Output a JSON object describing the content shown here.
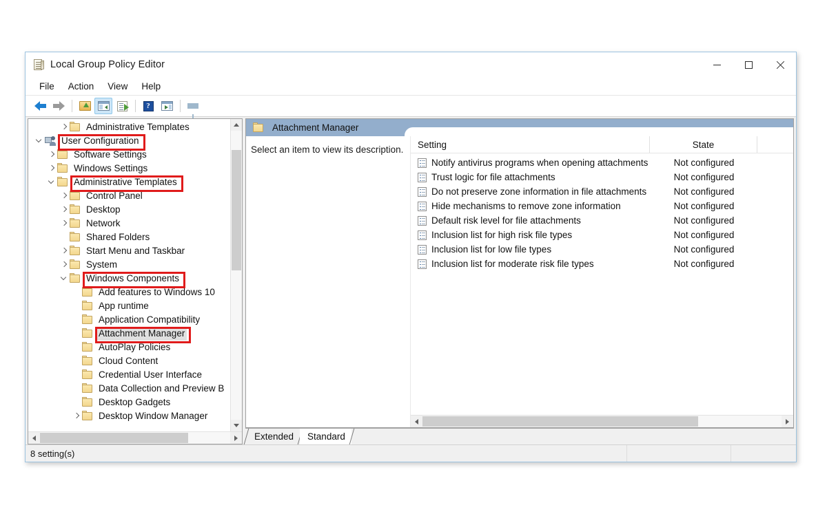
{
  "window": {
    "title": "Local Group Policy Editor",
    "icon": "policy-document-icon",
    "controls": {
      "minimize": "—",
      "maximize": "□",
      "close": "✕"
    }
  },
  "menubar": {
    "items": [
      {
        "label": "File"
      },
      {
        "label": "Action"
      },
      {
        "label": "View"
      },
      {
        "label": "Help"
      }
    ]
  },
  "toolbar": {
    "buttons": [
      {
        "name": "back-arrow-icon",
        "tooltip": "Back"
      },
      {
        "name": "forward-arrow-icon",
        "tooltip": "Forward"
      },
      {
        "name": "up-one-level-icon",
        "tooltip": "Up One Level"
      },
      {
        "name": "show-hide-console-tree-icon",
        "tooltip": "Show/Hide Console Tree",
        "pressed": true
      },
      {
        "name": "export-list-icon",
        "tooltip": "Export List"
      },
      {
        "name": "help-icon",
        "tooltip": "Help",
        "glyph": "?"
      },
      {
        "name": "properties-icon",
        "tooltip": "Properties"
      },
      {
        "name": "filter-funnel-icon",
        "tooltip": "Filter"
      }
    ]
  },
  "tree": {
    "items": [
      {
        "label": "Administrative Templates",
        "depth": 2,
        "expander": "collapsed",
        "icon": "folder-icon",
        "selected": false,
        "highlighted": false
      },
      {
        "label": "User Configuration",
        "depth": 0,
        "expander": "expanded",
        "icon": "user-configuration-icon",
        "selected": false,
        "highlighted": true
      },
      {
        "label": "Software Settings",
        "depth": 1,
        "expander": "collapsed",
        "icon": "folder-icon",
        "selected": false,
        "highlighted": false
      },
      {
        "label": "Windows Settings",
        "depth": 1,
        "expander": "collapsed",
        "icon": "folder-icon",
        "selected": false,
        "highlighted": false
      },
      {
        "label": "Administrative Templates",
        "depth": 1,
        "expander": "expanded",
        "icon": "folder-icon",
        "selected": false,
        "highlighted": true
      },
      {
        "label": "Control Panel",
        "depth": 2,
        "expander": "collapsed",
        "icon": "folder-icon",
        "selected": false,
        "highlighted": false
      },
      {
        "label": "Desktop",
        "depth": 2,
        "expander": "collapsed",
        "icon": "folder-icon",
        "selected": false,
        "highlighted": false
      },
      {
        "label": "Network",
        "depth": 2,
        "expander": "collapsed",
        "icon": "folder-icon",
        "selected": false,
        "highlighted": false
      },
      {
        "label": "Shared Folders",
        "depth": 2,
        "expander": "none",
        "icon": "folder-icon",
        "selected": false,
        "highlighted": false
      },
      {
        "label": "Start Menu and Taskbar",
        "depth": 2,
        "expander": "collapsed",
        "icon": "folder-icon",
        "selected": false,
        "highlighted": false
      },
      {
        "label": "System",
        "depth": 2,
        "expander": "collapsed",
        "icon": "folder-icon",
        "selected": false,
        "highlighted": false
      },
      {
        "label": "Windows Components",
        "depth": 2,
        "expander": "expanded",
        "icon": "folder-icon",
        "selected": false,
        "highlighted": true
      },
      {
        "label": "Add features to Windows 10",
        "depth": 3,
        "expander": "none",
        "icon": "folder-icon",
        "selected": false,
        "highlighted": false
      },
      {
        "label": "App runtime",
        "depth": 3,
        "expander": "none",
        "icon": "folder-icon",
        "selected": false,
        "highlighted": false
      },
      {
        "label": "Application Compatibility",
        "depth": 3,
        "expander": "none",
        "icon": "folder-icon",
        "selected": false,
        "highlighted": false
      },
      {
        "label": "Attachment Manager",
        "depth": 3,
        "expander": "none",
        "icon": "folder-icon",
        "selected": true,
        "highlighted": true
      },
      {
        "label": "AutoPlay Policies",
        "depth": 3,
        "expander": "none",
        "icon": "folder-icon",
        "selected": false,
        "highlighted": false
      },
      {
        "label": "Cloud Content",
        "depth": 3,
        "expander": "none",
        "icon": "folder-icon",
        "selected": false,
        "highlighted": false
      },
      {
        "label": "Credential User Interface",
        "depth": 3,
        "expander": "none",
        "icon": "folder-icon",
        "selected": false,
        "highlighted": false
      },
      {
        "label": "Data Collection and Preview B",
        "depth": 3,
        "expander": "none",
        "icon": "folder-icon",
        "selected": false,
        "highlighted": false
      },
      {
        "label": "Desktop Gadgets",
        "depth": 3,
        "expander": "none",
        "icon": "folder-icon",
        "selected": false,
        "highlighted": false
      },
      {
        "label": "Desktop Window Manager",
        "depth": 3,
        "expander": "collapsed",
        "icon": "folder-icon",
        "selected": false,
        "highlighted": false
      }
    ]
  },
  "right_panel": {
    "tab_title": "Attachment Manager",
    "tab_icon": "folder-icon",
    "description": "Select an item to view its description.",
    "columns": {
      "setting": "Setting",
      "state": "State",
      "comment": ""
    },
    "rows": [
      {
        "setting": "Notify antivirus programs when opening attachments",
        "state": "Not configured"
      },
      {
        "setting": "Trust logic for file attachments",
        "state": "Not configured"
      },
      {
        "setting": "Do not preserve zone information in file attachments",
        "state": "Not configured"
      },
      {
        "setting": "Hide mechanisms to remove zone information",
        "state": "Not configured"
      },
      {
        "setting": "Default risk level for file attachments",
        "state": "Not configured"
      },
      {
        "setting": "Inclusion list for high risk file types",
        "state": "Not configured"
      },
      {
        "setting": "Inclusion list for low file types",
        "state": "Not configured"
      },
      {
        "setting": "Inclusion list for moderate risk file types",
        "state": "Not configured"
      }
    ]
  },
  "bottom_tabs": [
    {
      "label": "Extended",
      "active": false
    },
    {
      "label": "Standard",
      "active": true
    }
  ],
  "statusbar": {
    "text": "8 setting(s)"
  },
  "colors": {
    "annotation": "#e01b1b",
    "panel_header": "#93aecc",
    "window_border": "#9cc3e0",
    "selection": "#e0e0e0"
  }
}
